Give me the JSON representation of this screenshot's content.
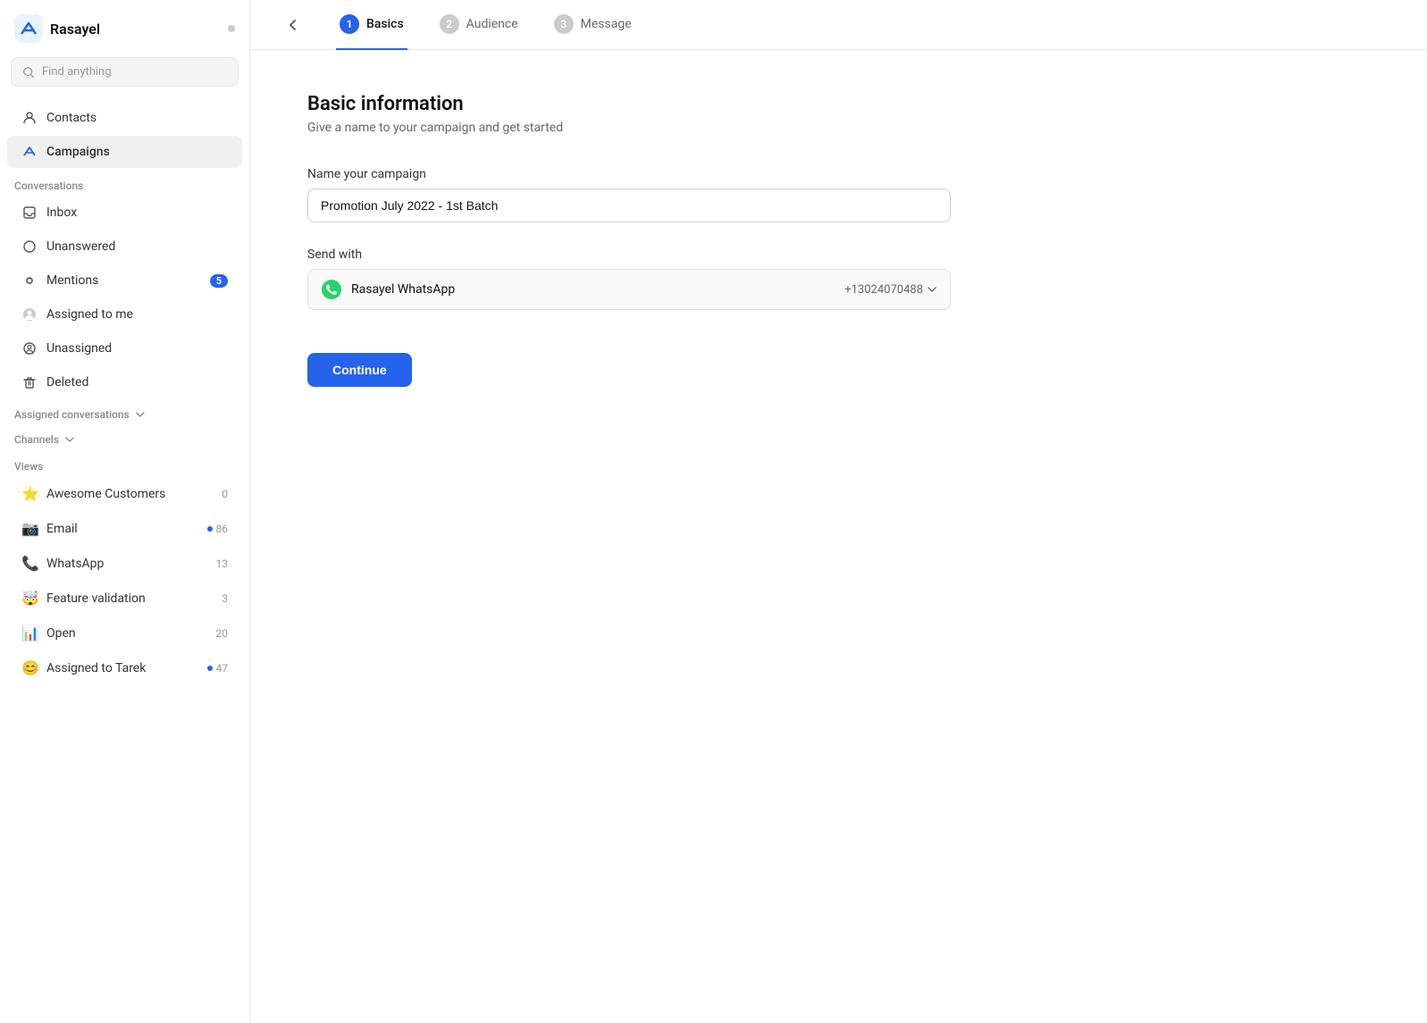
{
  "app": {
    "title": "Rasayel",
    "status_dot_color": "#ccc"
  },
  "search": {
    "placeholder": "Find anything"
  },
  "sidebar": {
    "nav_items": [
      {
        "id": "contacts",
        "label": "Contacts",
        "icon": "contacts-icon"
      },
      {
        "id": "campaigns",
        "label": "Campaigns",
        "icon": "campaigns-icon",
        "active": true
      }
    ],
    "conversations_section": "Conversations",
    "conversation_items": [
      {
        "id": "inbox",
        "label": "Inbox",
        "icon": "inbox-icon"
      },
      {
        "id": "unanswered",
        "label": "Unanswered",
        "icon": "unanswered-icon"
      },
      {
        "id": "mentions",
        "label": "Mentions",
        "icon": "mentions-icon",
        "badge": "5"
      },
      {
        "id": "assigned-to-me",
        "label": "Assigned to me",
        "icon": "assigned-me-icon"
      },
      {
        "id": "unassigned",
        "label": "Unassigned",
        "icon": "unassigned-icon"
      },
      {
        "id": "deleted",
        "label": "Deleted",
        "icon": "deleted-icon"
      }
    ],
    "assigned_conversations_label": "Assigned conversations",
    "channels_label": "Channels",
    "views_label": "Views",
    "view_items": [
      {
        "id": "awesome-customers",
        "label": "Awesome Customers",
        "emoji": "⭐",
        "count": "0",
        "count_type": "plain"
      },
      {
        "id": "email",
        "label": "Email",
        "emoji": "📷",
        "count": "86",
        "count_type": "dot"
      },
      {
        "id": "whatsapp",
        "label": "WhatsApp",
        "emoji": "📞",
        "count": "13",
        "count_type": "plain"
      },
      {
        "id": "feature-validation",
        "label": "Feature validation",
        "emoji": "🤯",
        "count": "3",
        "count_type": "plain"
      },
      {
        "id": "open",
        "label": "Open",
        "emoji": "📊",
        "count": "20",
        "count_type": "plain"
      },
      {
        "id": "assigned-to-tarek",
        "label": "Assigned to Tarek",
        "emoji": "😊",
        "count": "47",
        "count_type": "dot"
      }
    ]
  },
  "top_nav": {
    "back_label": "back",
    "steps": [
      {
        "id": "basics",
        "number": "1",
        "label": "Basics",
        "active": true
      },
      {
        "id": "audience",
        "number": "2",
        "label": "Audience",
        "active": false
      },
      {
        "id": "message",
        "number": "3",
        "label": "Message",
        "active": false
      }
    ]
  },
  "form": {
    "title": "Basic information",
    "subtitle": "Give a name to your campaign and get started",
    "name_label": "Name your campaign",
    "name_value": "Promotion July 2022 - 1st Batch",
    "send_with_label": "Send with",
    "send_with_name": "Rasayel WhatsApp",
    "send_with_number": "+13024070488",
    "continue_label": "Continue"
  }
}
